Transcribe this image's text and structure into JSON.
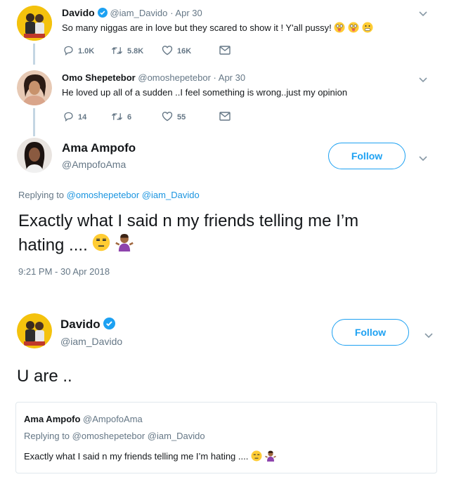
{
  "tweet1": {
    "name": "Davido",
    "handle": "@iam_Davido",
    "date": "· Apr 30",
    "text": "So many niggas are in love but they scared to show it ! Y'all pussy!",
    "reply_count": "1.0K",
    "retweet_count": "5.8K",
    "like_count": "16K"
  },
  "tweet2": {
    "name": "Omo Shepetebor",
    "handle": "@omoshepetebor",
    "date": "· Apr 30",
    "text": "He loved up all of a sudden ..I feel something is wrong..just my opinion",
    "reply_count": "14",
    "retweet_count": "6",
    "like_count": "55"
  },
  "tweet3": {
    "name": "Ama Ampofo",
    "handle": "@AmpofoAma",
    "follow_label": "Follow",
    "replying_prefix": "Replying to",
    "replying_user1": "@omoshepetebor",
    "replying_user2": "@iam_Davido",
    "text_line1": "Exactly what I said n my friends telling me I’m",
    "text_line2": "hating ....",
    "timestamp": "9:21 PM - 30 Apr 2018"
  },
  "tweet4": {
    "name": "Davido",
    "handle": "@iam_Davido",
    "follow_label": "Follow",
    "text": "U are ..",
    "quote": {
      "name": "Ama Ampofo",
      "handle": "@AmpofoAma",
      "replying": "Replying to @omoshepetebor @iam_Davido",
      "text": "Exactly what I said n my friends telling me I’m hating ...."
    }
  },
  "colors": {
    "accent": "#1da1f2",
    "link": "#1b95e0",
    "muted": "#657786",
    "verified": "#1da1f2",
    "thread_line": "#c4d6e3"
  }
}
